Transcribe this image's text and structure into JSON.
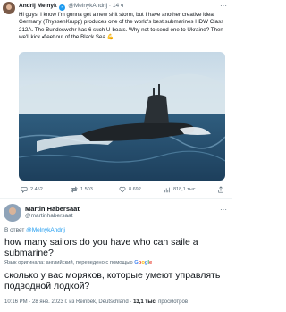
{
  "tweet1": {
    "author_name": "Andrij Melnyk",
    "handle": "@MelnykAndrij",
    "time": "· 14 ч",
    "text": "Hi guys, I know I'm gonna get a new shit storm, but I have another creative idea. Germany (ThyssenKrupp) produces one of the world's best submarines HDW Class 212A. The Bundeswehr has 6 such U-boats. Why not to send one to Ukraine? Then we'll kick ▪fleet out of the Black Sea 💪",
    "image_alt": "submarine-photo",
    "replies": "2 452",
    "reposts": "1 503",
    "likes": "8 692",
    "views": "818,1 тыс."
  },
  "tweet2": {
    "author_name": "Martin Habersaat",
    "handle": "@martinhabersaat",
    "reply_prefix": "В ответ",
    "reply_to": "@MelnykAndrij",
    "text": "how many sailors do you have who can saile a submarine?",
    "translate_note": "Язык оригинала: английский, переведено с помощью",
    "translate_brand": "Google",
    "translation": "сколько у вас моряков, которые умеют управлять подводной лодкой?",
    "meta_time": "10:16 PM · 28 янв. 2023 г. из Reinbek, Deutschland ·",
    "meta_views": "13,1 тыс.",
    "meta_views_label": "просмотров"
  },
  "colors": {
    "accent": "#1d9bf0",
    "muted": "#536471",
    "text": "#0f1419"
  }
}
